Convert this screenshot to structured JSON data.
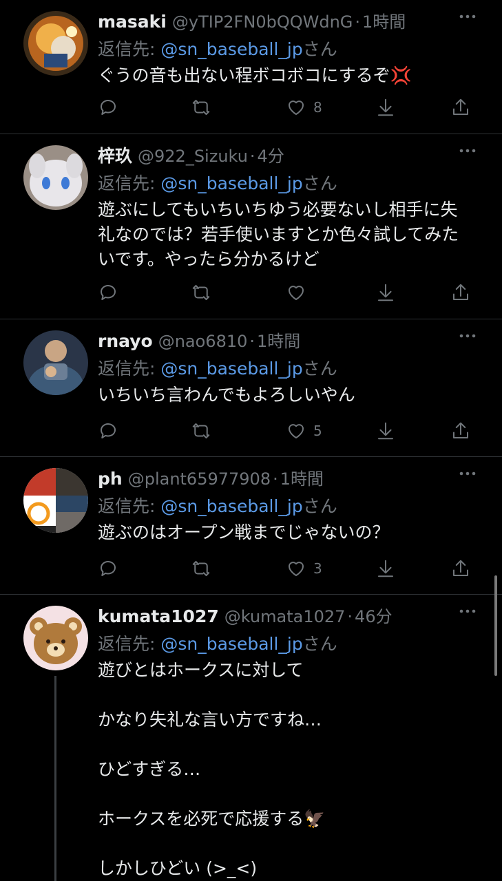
{
  "tweets": [
    {
      "name": "masaki",
      "handle": "@yTIP2FN0bQQWdnG",
      "time": "1時間",
      "reply_prefix": "返信先: ",
      "mention": "@sn_baseball_jp",
      "reply_suffix": "さん",
      "text": "ぐうの音も出ない程ボコボコにするぞ💢",
      "likes": "8",
      "avatar_icon": "baseball-player-photo"
    },
    {
      "name": "梓玖",
      "handle": "@922_Sizuku",
      "time": "4分",
      "reply_prefix": "返信先: ",
      "mention": "@sn_baseball_jp",
      "reply_suffix": "さん",
      "text": "遊ぶにしてもいちいちゆう必要ないし相手に失\n礼なのでは？若手使いますとか色々試してみた\nいです。やったら分かるけど",
      "likes": "",
      "avatar_icon": "white-plush-photo"
    },
    {
      "name": "rnayo",
      "handle": "@nao6810",
      "time": "1時間",
      "reply_prefix": "返信先: ",
      "mention": "@sn_baseball_jp",
      "reply_suffix": "さん",
      "text": "いちいち言わんでもよろしいやん",
      "likes": "5",
      "avatar_icon": "person-photo"
    },
    {
      "name": "ph",
      "handle": "@plant65977908",
      "time": "1時間",
      "reply_prefix": "返信先: ",
      "mention": "@sn_baseball_jp",
      "reply_suffix": "さん",
      "text": "遊ぶのはオープン戦までじゃないの？",
      "likes": "3",
      "avatar_icon": "collage-photo"
    },
    {
      "name": "kumata1027",
      "handle": "@kumata1027",
      "time": "46分",
      "reply_prefix": "返信先: ",
      "mention": "@sn_baseball_jp",
      "reply_suffix": "さん",
      "text": "遊びとはホークスに対して\n\nかなり失礼な言い方ですね…\n\nひどすぎる…\n\nホークスを必死で応援する🦅\n\nしかしひどい (>_<)",
      "likes": "",
      "avatar_icon": "bear-character-icon"
    }
  ],
  "dot": "·",
  "colors": {
    "background": "#000000",
    "mention": "#5b9ae6",
    "muted": "#71767b",
    "divider": "#2f3336"
  }
}
